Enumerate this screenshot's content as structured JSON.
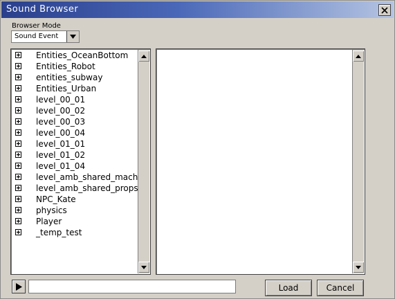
{
  "window": {
    "title": "Sound Browser"
  },
  "browser_mode": {
    "label": "Browser Mode",
    "selected": "Sound Event"
  },
  "tree": {
    "items": [
      "Entities_OceanBottom",
      "Entities_Robot",
      "entities_subway",
      "Entities_Urban",
      "level_00_01",
      "level_00_02",
      "level_00_03",
      "level_00_04",
      "level_01_01",
      "level_01_02",
      "level_01_04",
      "level_amb_shared_machi",
      "level_amb_shared_props",
      "NPC_Kate",
      "physics",
      "Player",
      "_temp_test"
    ]
  },
  "footer": {
    "path_value": "",
    "load_label": "Load",
    "cancel_label": "Cancel"
  },
  "icons": {
    "close": "close-icon",
    "play": "play-icon",
    "expand": "plus-box-icon",
    "scroll_up": "arrow-up-icon",
    "scroll_down": "arrow-down-icon",
    "dropdown": "chevron-down-icon"
  }
}
